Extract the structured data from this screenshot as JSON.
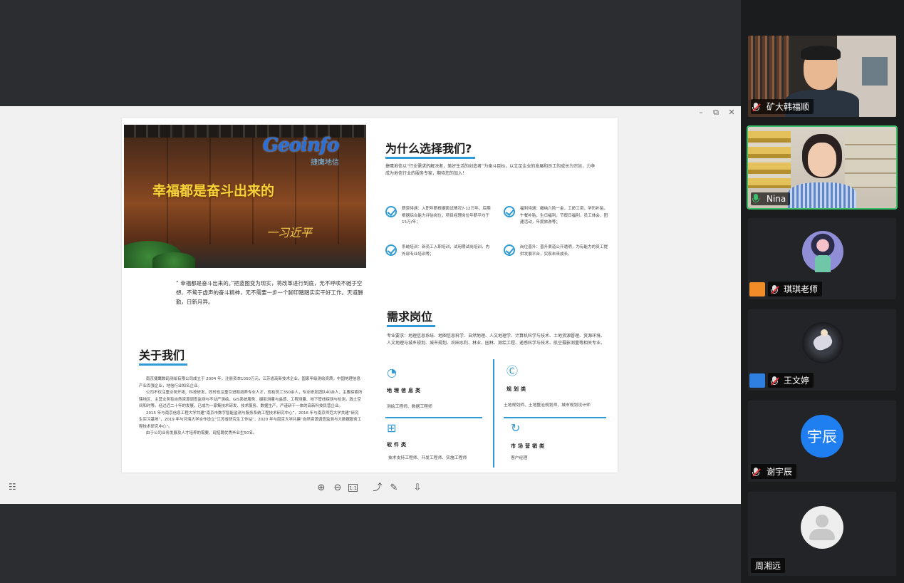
{
  "viewer": {
    "window_controls": {
      "minimize": "–",
      "restore": "⧉",
      "close": "✕"
    }
  },
  "brochure": {
    "photo": {
      "logo_text": "Geoinfo",
      "logo_cn": "捷鹰地信",
      "slogan": "幸福都是奋斗出来的",
      "signature": "一习近平"
    },
    "quote": "“ 幸福都是奋斗出来的。”把蓝图变为现实，将改革进行到底，无不呼唤不驰于空想、不鹜于虚声的奋斗精神，无不需要一步一个脚印踏踏实实干好工作。天道酬勤，日新月异。",
    "about": {
      "title": "关于我们",
      "paragraphs": [
        "南京捷鹰数码测绘有限公司成立于 2004 年，注册资本1050万元，江苏省高新技术企业，国家甲级测绘资质，中国地理信息产业百强企业，地信行业知名企业。",
        "公司不仅注重业务开拓、科技研发，同时也注重引进和培养专业人才，现有员工350余人，专业研发团队40余人，主要探索所辖地区、主营业务有自然资源调查监测与不动产测绘、GIS系统服务、摄影测量与遥感、工程测量、地下管线探测与检测，践土空间和时等。经过近二十年的发展，已成为一家集技术研发、技术服务、数据生产，严谨研干一体的高新科技民营企业。",
        "2015 年与南京信息工程大学共建“南京市数字智能监测与服务系统工程技术研究中心”，2016 年与南京师范大学共建“研究生实习基地”，2019 年与河海大学合作设立“江苏省研究生工作站”，2020 年与南京大学共建“自然资源调查监测与大数据服务工程技术研究中心”。",
        "由于公司业务发展及人才培养的需要，现招聘优秀毕业生50名。"
      ]
    },
    "why": {
      "title": "为什么选择我们?",
      "intro": "捷鹰地信以“行业需求的解决者，美好生活的创造者”为奋斗目标，以立足企业的发展和员工的成长为宗旨，力争成为地信行业的服务专家，期待您的加入！",
      "benefits": [
        "薪资待遇：入职年薪根据面试情况7-12万年，后期根据综合能力评估岗位，项目经理岗位年薪平均于15万/年；",
        "福利待遇：缴纳六险一金，工龄工资，学历补贴，午餐补贴，生日福利，节假日福利，员工体会，团建活动，年度旅游等；",
        "系统培训：新员工入职培训，试用期试岗培训，内外部专业培训等；",
        "岗位晋升：晋升渠道公开透明，为有能力的员工提供发展平台，实现未来成长。"
      ]
    },
    "jobs": {
      "title": "需求岗位",
      "requirements": "专业要求：地理信息系统、地图信息科学、自然地理、人文地理学、计算机科学与技术、土地资源管理、资源环境、人文地理与城乡规划、城市规划、农田水利、林业、园林、测绘工程、遥感科学与技术、航空摄影测量等相关专业。",
      "categories": [
        {
          "icon": "◔",
          "title": "地理信息类",
          "desc": "测绘工程师、数据工程师"
        },
        {
          "icon": "Ⓒ",
          "title": "规划类",
          "desc": "土地规划师、土地整治规划师、城市规划设计师"
        },
        {
          "icon": "⊞",
          "title": "软件类",
          "desc": "技术支持工程师、开发工程师、实施工程师"
        },
        {
          "icon": "↻",
          "title": "市场营销类",
          "desc": "客户经理"
        }
      ]
    }
  },
  "toolbar": {
    "thumbnails": "☷",
    "zoom_in": "⊕",
    "zoom_out": "⊖",
    "fit": "1:1",
    "rotate": "⤴",
    "annotate": "✎",
    "download": "⇩"
  },
  "participants": [
    {
      "name": "矿大韩福顺",
      "mic": "muted",
      "kind": "video"
    },
    {
      "name": "Nina",
      "mic": "on",
      "kind": "video",
      "active": true
    },
    {
      "name": "琪琪老师",
      "mic": "muted",
      "kind": "avatar",
      "host": true
    },
    {
      "name": "王文婷",
      "mic": "muted",
      "kind": "avatar",
      "host": true
    },
    {
      "name": "谢宇辰",
      "mic": "muted",
      "kind": "initials",
      "initials": "宇辰"
    },
    {
      "name": "周湘远",
      "mic": "none",
      "kind": "placeholder"
    }
  ],
  "colors": {
    "accent": "#2e9ad6",
    "active_speaker": "#3dbf6a",
    "host_badge": "#f08c28",
    "cohost_badge": "#2f7fe0",
    "initials_bg": "#1f7ff0"
  }
}
